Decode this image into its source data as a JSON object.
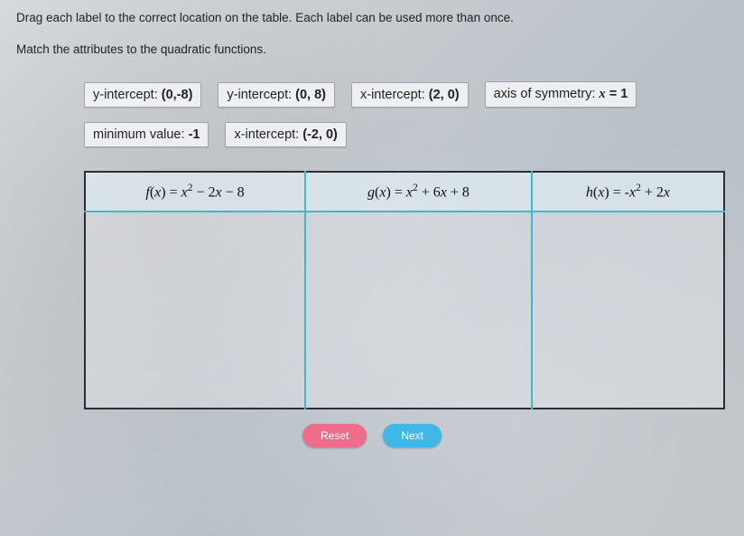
{
  "instructions": {
    "line1": "Drag each label to the correct location on the table. Each label can be used more than once.",
    "line2": "Match the attributes to the quadratic functions."
  },
  "labels": {
    "yint_neg8_prefix": "y-intercept: ",
    "yint_neg8_val": "(0,-8)",
    "yint_8_prefix": "y-intercept: ",
    "yint_8_val": "(0, 8)",
    "xint_2_prefix": "x-intercept: ",
    "xint_2_val": "(2, 0)",
    "axis_prefix": "axis of symmetry: ",
    "axis_var": "x",
    "axis_eq": " = 1",
    "min_prefix": "minimum value: ",
    "min_val": "-1",
    "xint_neg2_prefix": "x-intercept: ",
    "xint_neg2_val": "(-2, 0)"
  },
  "table": {
    "f_name": "f",
    "f_open": "(",
    "f_x": "x",
    "f_close": ") = ",
    "f_x2": "x",
    "f_rest": " − 2",
    "f_x3": "x",
    "f_tail": " − 8",
    "g_name": "g",
    "g_open": "(",
    "g_x": "x",
    "g_close": ") = ",
    "g_x2": "x",
    "g_rest": " + 6",
    "g_x3": "x",
    "g_tail": " + 8",
    "h_name": "h",
    "h_open": "(",
    "h_x": "x",
    "h_close": ") = -",
    "h_x2": "x",
    "h_rest": " + 2",
    "h_x3": "x",
    "sq": "2"
  },
  "buttons": {
    "reset": "Reset",
    "next": "Next"
  }
}
